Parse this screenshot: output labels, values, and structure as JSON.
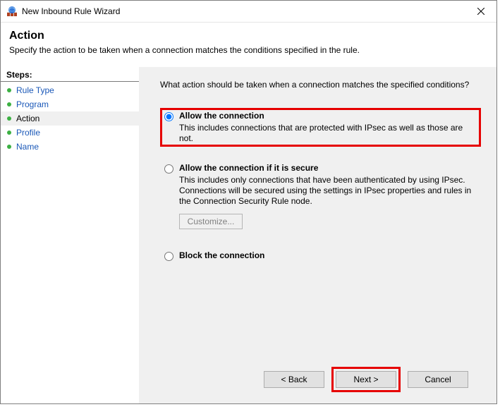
{
  "window": {
    "title": "New Inbound Rule Wizard"
  },
  "header": {
    "title": "Action",
    "subtitle": "Specify the action to be taken when a connection matches the conditions specified in the rule."
  },
  "steps": {
    "title": "Steps:",
    "items": [
      {
        "label": "Rule Type",
        "current": false
      },
      {
        "label": "Program",
        "current": false
      },
      {
        "label": "Action",
        "current": true
      },
      {
        "label": "Profile",
        "current": false
      },
      {
        "label": "Name",
        "current": false
      }
    ]
  },
  "content": {
    "question": "What action should be taken when a connection matches the specified conditions?",
    "options": [
      {
        "id": "allow",
        "title": "Allow the connection",
        "desc": "This includes connections that are protected with IPsec as well as those are not.",
        "selected": true,
        "highlight": true
      },
      {
        "id": "allow-secure",
        "title": "Allow the connection if it is secure",
        "desc": "This includes only connections that have been authenticated by using IPsec.  Connections will be secured using the settings in IPsec properties and rules in the Connection Security Rule node.",
        "selected": false,
        "customize_label": "Customize...",
        "customize_enabled": false
      },
      {
        "id": "block",
        "title": "Block the connection",
        "selected": false
      }
    ]
  },
  "footer": {
    "back": "< Back",
    "next": "Next >",
    "cancel": "Cancel",
    "next_highlight": true
  }
}
